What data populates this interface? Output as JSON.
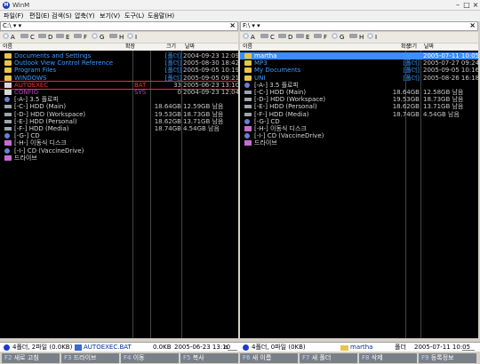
{
  "app": {
    "title": "WinM"
  },
  "window_buttons": [
    "–",
    "□",
    "×"
  ],
  "menu": [
    "파일(F)",
    "편집(E)",
    "검색(S)",
    "압축(Y)",
    "보기(V)",
    "도구(L)",
    "도움말(H)"
  ],
  "left": {
    "path": "C:\\ ▾ ▾",
    "drives": [
      {
        "letter": "A",
        "type": "disc"
      },
      {
        "letter": "C",
        "type": "drive"
      },
      {
        "letter": "D",
        "type": "drive"
      },
      {
        "letter": "E",
        "type": "drive"
      },
      {
        "letter": "F",
        "type": "drive"
      },
      {
        "letter": "G",
        "type": "disc"
      },
      {
        "letter": "H",
        "type": "drive"
      },
      {
        "letter": "I",
        "type": "disc"
      }
    ],
    "header": {
      "name": "이름",
      "ext": "확장",
      "size": "크기",
      "date": "날짜"
    },
    "rows": [
      {
        "name": "Documents and Settings",
        "ext": "",
        "size": "[폴더]",
        "date": "2004-09-23 12:09",
        "color": "#3a9cff",
        "icon": "folder"
      },
      {
        "name": "Outlook View Control Reference",
        "ext": "",
        "size": "[폴더]",
        "date": "2005-08-30 18:42",
        "color": "#3a9cff",
        "icon": "folder"
      },
      {
        "name": "Program Files",
        "ext": "",
        "size": "[폴더]",
        "date": "2005-09-05 10:19",
        "color": "#3a9cff",
        "icon": "folder"
      },
      {
        "name": "WINDOWS",
        "ext": "",
        "size": "[폴더]",
        "date": "2005-09-05 09:21",
        "color": "#3a9cff",
        "icon": "folder"
      },
      {
        "name": "AUTOEXEC",
        "ext": "BAT",
        "size": "33",
        "date": "2005-06-23 13:10",
        "color": "#ff3030",
        "icon": "file",
        "selected": true
      },
      {
        "name": "CONFIG",
        "ext": "SYS",
        "size": "0",
        "date": "2004-09-23 12:04",
        "color": "#c040c0",
        "icon": "file"
      },
      {
        "name": "[-A-] 3.5 플로피",
        "ext": "",
        "size": "",
        "date": "",
        "color": "#d8d8d8",
        "icon": "disc"
      },
      {
        "name": "[-C-] HDD (Main)",
        "ext": "",
        "size": "18.64GB",
        "date": "12.59GB 남음",
        "color": "#d8d8d8",
        "icon": "drive"
      },
      {
        "name": "[-D-] HDD (Workspace)",
        "ext": "",
        "size": "19.53GB",
        "date": "18.73GB 남음",
        "color": "#d8d8d8",
        "icon": "drive"
      },
      {
        "name": "[-E-] HDD (Personal)",
        "ext": "",
        "size": "18.62GB",
        "date": "13.71GB 남음",
        "color": "#d8d8d8",
        "icon": "drive"
      },
      {
        "name": "[-F-] HDD (Media)",
        "ext": "",
        "size": "18.74GB",
        "date": "4.54GB 남음",
        "color": "#d8d8d8",
        "icon": "drive"
      },
      {
        "name": "[-G-] CD",
        "ext": "",
        "size": "",
        "date": "",
        "color": "#d8d8d8",
        "icon": "disc"
      },
      {
        "name": "[-H-] 이동식 디스크",
        "ext": "",
        "size": "",
        "date": "",
        "color": "#d8d8d8",
        "icon": "removable"
      },
      {
        "name": "[-I-] CD (VaccineDrive)",
        "ext": "",
        "size": "",
        "date": "",
        "color": "#d8d8d8",
        "icon": "disc"
      },
      {
        "name": "드라이브",
        "ext": "",
        "size": "",
        "date": "",
        "color": "#d8d8d8",
        "icon": "removable"
      }
    ],
    "status": {
      "summary": "4폴더, 2파일 (0.0KB)",
      "file": "AUTOEXEC.BAT",
      "size": "0.0KB",
      "date": "2005-06-23 13:10",
      "attr": "a___"
    }
  },
  "right": {
    "path": "F:\\ ▾ ▾",
    "drives": [
      {
        "letter": "A",
        "type": "disc"
      },
      {
        "letter": "C",
        "type": "drive"
      },
      {
        "letter": "D",
        "type": "drive"
      },
      {
        "letter": "E",
        "type": "drive"
      },
      {
        "letter": "F",
        "type": "drive"
      },
      {
        "letter": "G",
        "type": "disc"
      },
      {
        "letter": "H",
        "type": "drive"
      },
      {
        "letter": "I",
        "type": "disc"
      }
    ],
    "header": {
      "name": "이름",
      "ext": "확장",
      "size": "크기",
      "date": "날짜"
    },
    "rows": [
      {
        "name": "martha",
        "ext": "",
        "size": "[폴더]",
        "date": "2005-07-11 10:05",
        "color": "#ffffff",
        "icon": "folder",
        "highlight": true
      },
      {
        "name": "MP3",
        "ext": "",
        "size": "[폴더]",
        "date": "2005-07-27 09:24",
        "color": "#3a9cff",
        "icon": "folder"
      },
      {
        "name": "My Documents",
        "ext": "",
        "size": "[폴더]",
        "date": "2005-09-05 10:16",
        "color": "#3a9cff",
        "icon": "folder"
      },
      {
        "name": "UNI",
        "ext": "",
        "size": "[폴더]",
        "date": "2005-08-26 16:18",
        "color": "#3a9cff",
        "icon": "folder"
      },
      {
        "name": "[-A-] 3.5 플로피",
        "ext": "",
        "size": "",
        "date": "",
        "color": "#d8d8d8",
        "icon": "disc"
      },
      {
        "name": "[-C-] HDD (Main)",
        "ext": "",
        "size": "18.64GB",
        "date": "12.58GB 남음",
        "color": "#d8d8d8",
        "icon": "drive"
      },
      {
        "name": "[-D-] HDD (Workspace)",
        "ext": "",
        "size": "19.53GB",
        "date": "18.73GB 남음",
        "color": "#d8d8d8",
        "icon": "drive"
      },
      {
        "name": "[-E-] HDD (Personal)",
        "ext": "",
        "size": "18.62GB",
        "date": "13.71GB 남음",
        "color": "#d8d8d8",
        "icon": "drive"
      },
      {
        "name": "[-F-] HDD (Media)",
        "ext": "",
        "size": "18.74GB",
        "date": "4.54GB 남음",
        "color": "#d8d8d8",
        "icon": "drive"
      },
      {
        "name": "[-G-] CD",
        "ext": "",
        "size": "",
        "date": "",
        "color": "#d8d8d8",
        "icon": "disc"
      },
      {
        "name": "[-H-] 이동식 디스크",
        "ext": "",
        "size": "",
        "date": "",
        "color": "#d8d8d8",
        "icon": "removable"
      },
      {
        "name": "[-I-] CD (VaccineDrive)",
        "ext": "",
        "size": "",
        "date": "",
        "color": "#d8d8d8",
        "icon": "disc"
      },
      {
        "name": "드라이브",
        "ext": "",
        "size": "",
        "date": "",
        "color": "#d8d8d8",
        "icon": "removable"
      }
    ],
    "status": {
      "summary": "4폴더, 0파일 (0KB)",
      "file": "martha",
      "size": "폴더",
      "date": "2005-07-11 10:05",
      "attr": "____"
    }
  },
  "fkeys": [
    {
      "key": "F2",
      "label": "새로 고침"
    },
    {
      "key": "F3",
      "label": "드라이브"
    },
    {
      "key": "F4",
      "label": "이동"
    },
    {
      "key": "F5",
      "label": "복사"
    },
    {
      "key": "F6",
      "label": "새 이름"
    },
    {
      "key": "F7",
      "label": "새 폴더"
    },
    {
      "key": "F8",
      "label": "삭제"
    },
    {
      "key": "F9",
      "label": "등록정보"
    }
  ],
  "colors": {
    "selection_outline": "#ff2050",
    "highlight_bg": "#3c8cff",
    "size_text": "#c8c8c8",
    "date_text": "#c8c8c8",
    "folder_tag": "#3a9cff"
  }
}
